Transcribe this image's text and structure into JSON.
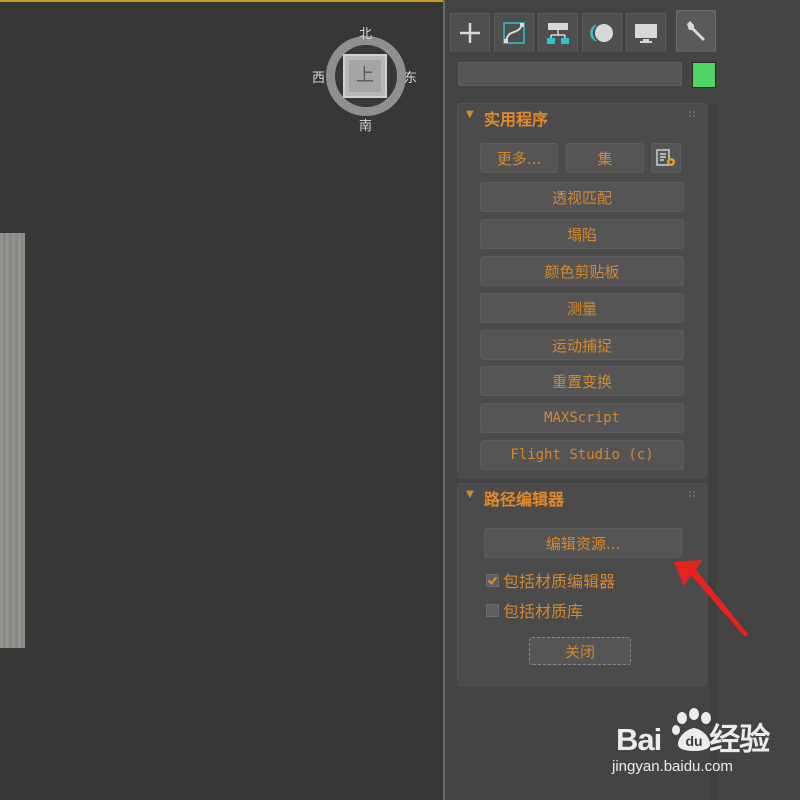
{
  "viewport": {
    "viewcube": {
      "north": "北",
      "south": "南",
      "west": "西",
      "east": "东",
      "face": "上"
    }
  },
  "command_panel": {
    "tabs": [
      {
        "icon": "plus-icon",
        "label": "create"
      },
      {
        "icon": "modify-curve-icon",
        "label": "modify"
      },
      {
        "icon": "hierarchy-icon",
        "label": "hierarchy"
      },
      {
        "icon": "motion-icon",
        "label": "motion"
      },
      {
        "icon": "display-monitor-icon",
        "label": "display"
      },
      {
        "icon": "wrench-icon",
        "label": "utilities"
      }
    ],
    "active_tab": "utilities",
    "name_field": {
      "value": ""
    },
    "object_color": "#4ed462"
  },
  "utilities_rollout": {
    "title": "实用程序",
    "more_button": "更多...",
    "sets_button": "集",
    "config_icon": "configure-button-sets-icon",
    "buttons": [
      "透视匹配",
      "塌陷",
      "颜色剪贴板",
      "测量",
      "运动捕捉",
      "重置变换",
      "MAXScript",
      "Flight Studio (c)"
    ]
  },
  "path_editor_rollout": {
    "title": "路径编辑器",
    "edit_resources_button": "编辑资源...",
    "include_material_editor": {
      "label": "包括材质编辑器",
      "checked": true
    },
    "include_material_library": {
      "label": "包括材质库",
      "checked": false
    },
    "close_button": "关闭"
  },
  "annotation": {
    "arrow_color": "#e8231f"
  },
  "watermark": {
    "brand_a": "Bai",
    "brand_b": "经验",
    "paw_text": "du",
    "url": "jingyan.baidu.com"
  },
  "accent_color": "#d4882d"
}
